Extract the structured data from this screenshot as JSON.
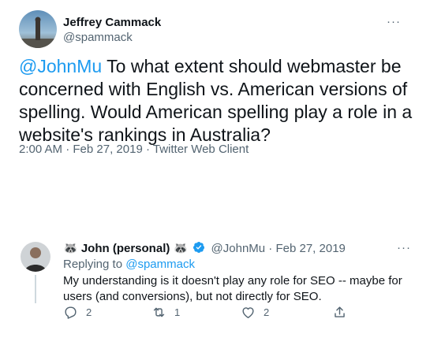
{
  "original_tweet": {
    "author_name": "Jeffrey Cammack",
    "author_handle": "@spammack",
    "more_label": "···",
    "mention": "@JohnMu",
    "text_line1_rest": " To what extent should webmaster be",
    "text_line2": "concerned with English vs. American versions of",
    "text_line3": "spelling.  Would American spelling play a role in a",
    "text_line4": "website's rankings in Australia?",
    "time": "2:00 AM",
    "date": "Feb 27, 2019",
    "client": "Twitter Web Client",
    "separator": " · "
  },
  "reply": {
    "author_name": "🦝 John (personal) 🦝",
    "author_handle": "@JohnMu",
    "date": "Feb 27, 2019",
    "separator": " · ",
    "replying_to_label": "Replying to ",
    "replying_to_handle": "@spammack",
    "more_label": "···",
    "text": "My understanding is it doesn't play any role for SEO -- maybe for users (and conversions), but not directly for SEO.",
    "actions": {
      "reply_count": "2",
      "retweet_count": "1",
      "like_count": "2"
    }
  },
  "colors": {
    "link": "#1d9bf0",
    "secondary_text": "#536471",
    "verified": "#1d9bf0"
  },
  "icons": [
    "reply-icon",
    "retweet-icon",
    "like-icon",
    "share-icon",
    "verified-badge-icon",
    "more-icon"
  ]
}
